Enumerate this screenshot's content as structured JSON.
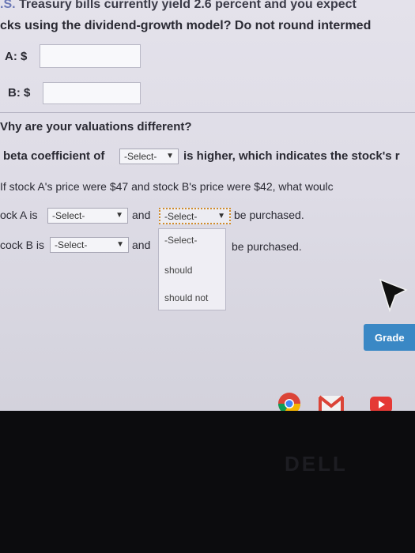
{
  "question": {
    "top_prefix": ".S.",
    "top_text": " Treasury bills currently yield 2.6 percent and you expect",
    "second_line": "cks using the dividend-growth model? Do not round intermed"
  },
  "answers": {
    "a_label": "A: $",
    "a_value": "",
    "b_label": "B: $",
    "b_value": ""
  },
  "why": {
    "heading": "Vhy are your valuations different?",
    "beta_prefix": "beta coefficient of",
    "beta_select": "-Select-",
    "beta_suffix": "is higher, which indicates the stock's r"
  },
  "purchase": {
    "question": "If stock A's price were $47 and stock B's price were $42, what woulc",
    "row_a_prefix": "ock A is",
    "row_a_select1": "-Select-",
    "row_a_and": "and",
    "row_a_select2": "-Select-",
    "row_a_suffix": "be purchased.",
    "row_b_prefix": "cock B is",
    "row_b_select1": "-Select-",
    "row_b_and": "and",
    "row_b_suffix": "be purchased."
  },
  "dropdown": {
    "options": [
      "-Select-",
      "should",
      "should not"
    ]
  },
  "grade_button": "Grade",
  "bezel_logo": "DELL",
  "colors": {
    "grade_button": "#3a88c5",
    "focus_outline": "#d08c2c",
    "chrome_red": "#db4437",
    "chrome_yellow": "#f4b400",
    "chrome_green": "#0f9d58",
    "youtube_red": "#e53935"
  },
  "icons": [
    "cursor-arrow-icon",
    "chrome-icon",
    "gmail-icon",
    "youtube-icon"
  ]
}
